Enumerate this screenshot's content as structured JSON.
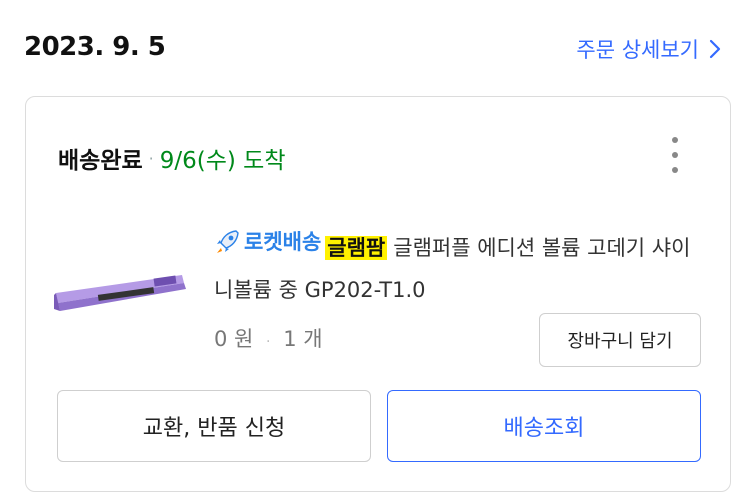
{
  "order": {
    "date": "2023. 9. 5",
    "detail_link_label": "주문 상세보기"
  },
  "delivery": {
    "status": "배송완료",
    "separator": "·",
    "arrival": "9/6(수) 도착"
  },
  "product": {
    "badge_label": "로켓배송",
    "brand": "글램팜",
    "name": "글램퍼플 에디션 볼륨 고데기 샤이니볼륨 중 GP202-T1.0",
    "price": "0 원",
    "price_separator": "·",
    "quantity": "1 개"
  },
  "buttons": {
    "add_to_cart": "장바구니 담기",
    "exchange_return": "교환, 반품 신청",
    "track_delivery": "배송조회"
  },
  "icons": {
    "more": "more-vertical-icon",
    "chevron": "chevron-right-icon",
    "rocket": "rocket-icon"
  },
  "colors": {
    "accent_blue": "#346aff",
    "rocket_blue": "#2b82e8",
    "delivered_green": "#00891a",
    "brand_highlight": "#fff100"
  }
}
